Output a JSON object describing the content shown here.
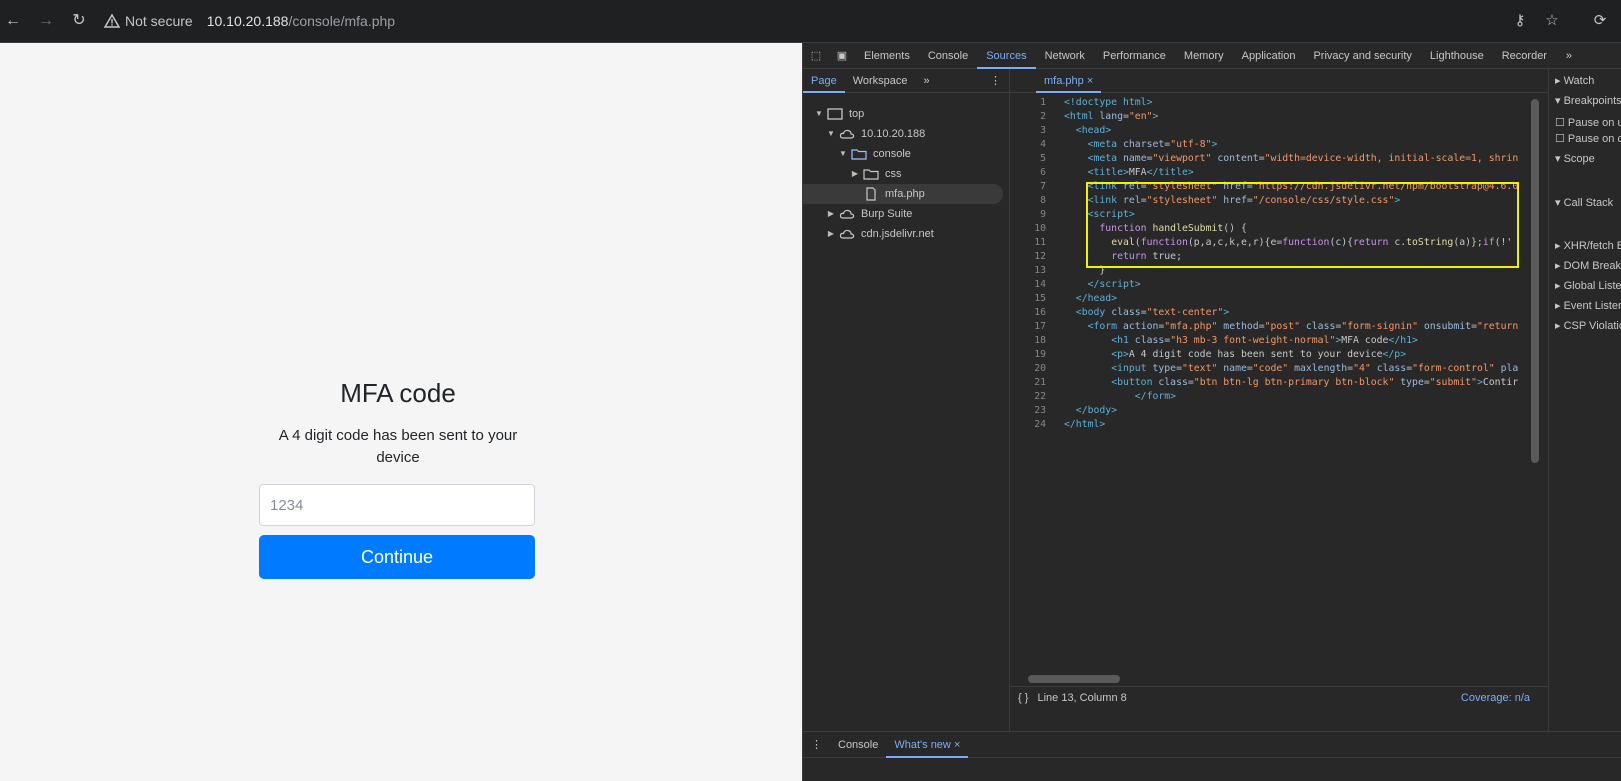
{
  "browser": {
    "security_label": "Not secure",
    "url_host": "10.10.20.188",
    "url_path": "/console/mfa.php",
    "back_icon": "arrow-left-icon",
    "forward_icon": "arrow-right-icon",
    "reload_icon": "reload-icon"
  },
  "page": {
    "title": "MFA code",
    "description": "A 4 digit code has been sent to your device",
    "code_placeholder": "1234",
    "continue_label": "Continue",
    "button_color": "#007bff"
  },
  "devtools": {
    "tabs": [
      "Elements",
      "Console",
      "Sources",
      "Network",
      "Performance",
      "Memory",
      "Application",
      "Privacy and security",
      "Lighthouse",
      "Recorder"
    ],
    "active_tab": "Sources",
    "navigator": {
      "tabs": [
        "Page",
        "Workspace"
      ],
      "tree": [
        {
          "label": "top"
        },
        {
          "label": "10.10.20.188"
        },
        {
          "label": "console"
        },
        {
          "label": "css"
        },
        {
          "label": "mfa.php"
        },
        {
          "label": "Burp Suite"
        },
        {
          "label": "cdn.jsdelivr.net"
        }
      ]
    },
    "editor": {
      "file_tab": "mfa.php",
      "status_position": "Line 13, Column 8",
      "coverage": "Coverage: n/a",
      "line_numbers": [
        "1",
        "2",
        "3",
        "4",
        "5",
        "6",
        "7",
        "8",
        "9",
        "10",
        "11",
        "12",
        "13",
        "14",
        "15",
        "16",
        "17",
        "18",
        "19",
        "20",
        "21",
        "22",
        "23",
        "24"
      ]
    },
    "debugger": {
      "sections": [
        "Watch",
        "Breakpoints",
        "Pause on u",
        "Pause on c",
        "Scope",
        "Call Stack",
        "XHR/fetch B",
        "DOM Break",
        "Global Liste",
        "Event Lister",
        "CSP Violatio"
      ]
    },
    "drawer": {
      "tabs": [
        "Console",
        "What's new"
      ],
      "active": "What's new"
    }
  }
}
